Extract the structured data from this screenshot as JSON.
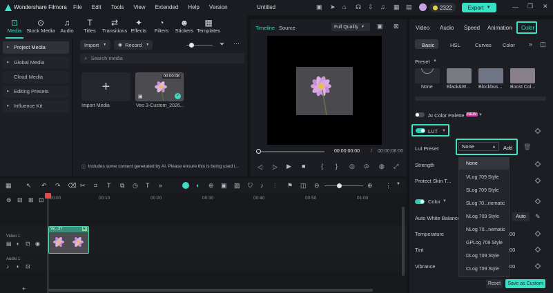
{
  "app": {
    "name": "Wondershare Filmora",
    "document_title": "Untitled",
    "credits": "2322",
    "export_label": "Export"
  },
  "menu": [
    "File",
    "Edit",
    "Tools",
    "View",
    "Extended",
    "Help",
    "Version"
  ],
  "toolbar": [
    {
      "label": "Media",
      "icon": "media-icon",
      "active": true
    },
    {
      "label": "Stock Media",
      "icon": "stock-media-icon"
    },
    {
      "label": "Audio",
      "icon": "audio-icon"
    },
    {
      "label": "Titles",
      "icon": "titles-icon"
    },
    {
      "label": "Transitions",
      "icon": "transitions-icon"
    },
    {
      "label": "Effects",
      "icon": "effects-icon"
    },
    {
      "label": "Filters",
      "icon": "filters-icon"
    },
    {
      "label": "Stickers",
      "icon": "stickers-icon"
    },
    {
      "label": "Templates",
      "icon": "templates-icon"
    }
  ],
  "sidebar": [
    "Project Media",
    "Global Media",
    "Cloud Media",
    "Editing Presets",
    "Influence Kit"
  ],
  "media": {
    "import_label": "Import",
    "record_label": "Record",
    "search_placeholder": "Search media",
    "import_tile_label": "Import Media",
    "clip_name": "Veo 3-Custom_2026...",
    "clip_duration": "00:00:08",
    "ai_notice": "Includes some content generated by AI. Please ensure this is being used i..."
  },
  "preview": {
    "tab_timeline": "Timeline",
    "tab_source": "Source",
    "quality": "Full Quality",
    "current_time": "00:00:00:00",
    "separator": "/",
    "total_time": "00:00:08:00"
  },
  "right_panel": {
    "tabs": [
      "Video",
      "Audio",
      "Speed",
      "Animation",
      "Color"
    ],
    "active_tab": "Color",
    "subtabs": [
      "Basic",
      "HSL",
      "Curves",
      "Color"
    ],
    "preset_label": "Preset",
    "presets": [
      "None",
      "Black&W...",
      "Blockbus...",
      "Boost Col..."
    ],
    "ai_color_palette": "AI Color Palette",
    "new_badge": "NEW",
    "lut_label": "LUT",
    "lut_preset_label": "Lut Preset",
    "lut_value": "None",
    "add_label": "Add",
    "strength_label": "Strength",
    "protect_skin_label": "Protect Skin T...",
    "color_label": "Color",
    "auto_white_balance_label": "Auto White Balance",
    "auto_label": "Auto",
    "temperature_label": "Temperature",
    "tint_label": "Tint",
    "vibrance_label": "Vibrance",
    "value_temp": "00",
    "value_tint": "00",
    "value_vib": "00",
    "reset_label": "Reset",
    "save_custom_label": "Save as Custom"
  },
  "lut_dropdown": [
    "None",
    "VLog 709 Style",
    "SLog 709 Style",
    "SLog 70...nematic",
    "NLog 709 Style",
    "NLog 70...nematic",
    "GPLog 709 Style",
    "DLog 709 Style",
    "CLog 709 Style"
  ],
  "timeline": {
    "ticks": [
      "00:00",
      "00:10",
      "00:20",
      "00:30",
      "00:40",
      "00:50",
      "01:00"
    ],
    "video_track": "Video 1",
    "audio_track": "Audio 1",
    "clip_label": "Ve...37",
    "ai_badge": "AI"
  },
  "colors": {
    "accent": "#3fe3c6",
    "export_bg": "#37e0c3",
    "playhead": "#e44a4a"
  }
}
